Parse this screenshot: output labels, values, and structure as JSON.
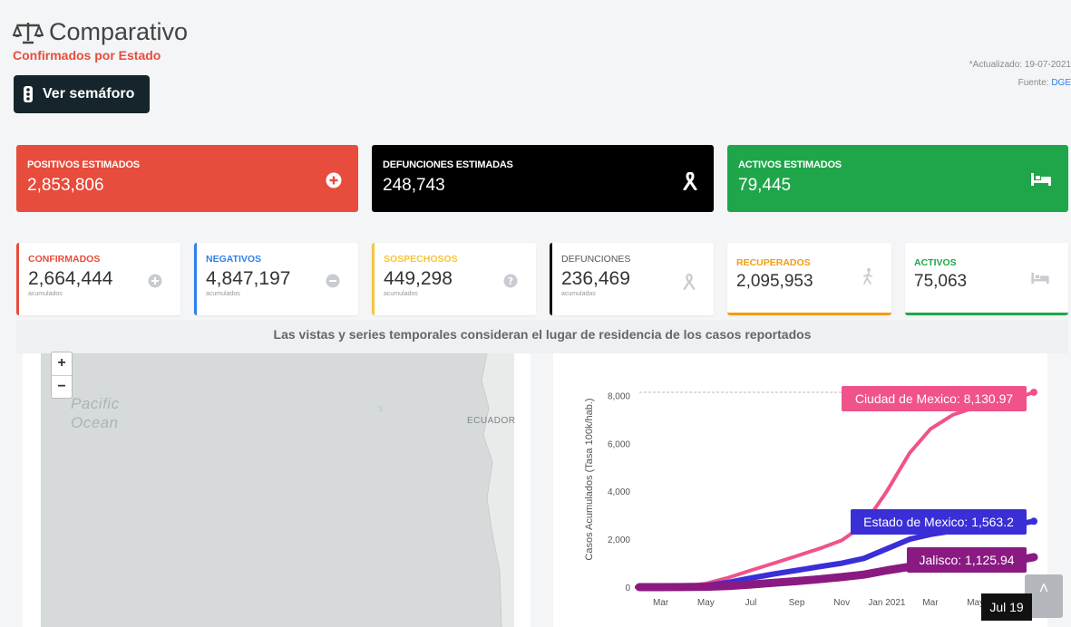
{
  "header": {
    "title": "Comparativo",
    "subtitle": "Confirmados por Estado",
    "semaforo_button": "Ver semáforo",
    "updated": "*Actualizado: 19-07-2021",
    "source_label": "Fuente:",
    "source_value": "DGE"
  },
  "big_cards": [
    {
      "label": "POSITIVOS ESTIMADOS",
      "value": "2,853,806",
      "color": "#e74c3c",
      "icon": "plus-circle-icon"
    },
    {
      "label": "DEFUNCIONES ESTIMADAS",
      "value": "248,743",
      "color": "#000000",
      "icon": "ribbon-icon"
    },
    {
      "label": "ACTIVOS ESTIMADOS",
      "value": "79,445",
      "color": "#1fa64a",
      "icon": "bed-icon"
    }
  ],
  "small_cards": [
    {
      "label": "CONFIRMADOS",
      "value": "2,664,444",
      "sub": "acumulados",
      "color": "#e74c3c",
      "icon": "plus-circle-icon"
    },
    {
      "label": "NEGATIVOS",
      "value": "4,847,197",
      "sub": "acumulados",
      "color": "#2f80ed",
      "icon": "minus-circle-icon"
    },
    {
      "label": "SOSPECHOSOS",
      "value": "449,298",
      "sub": "acumulados",
      "color": "#f4c542",
      "icon": "question-circle-icon"
    },
    {
      "label": "DEFUNCIONES",
      "value": "236,469",
      "sub": "acumuladas",
      "color": "#111111",
      "icon": "ribbon-icon"
    },
    {
      "label": "RECUPERADOS",
      "value": "2,095,953",
      "sub": "",
      "color": "#f39c12",
      "icon": "walking-icon"
    },
    {
      "label": "ACTIVOS",
      "value": "75,063",
      "sub": "",
      "color": "#1fa64a",
      "icon": "bed-icon"
    }
  ],
  "note": "Las vistas y series temporales consideran el lugar de residencia de los casos reportados",
  "map": {
    "zoom_in": "+",
    "zoom_out": "−",
    "ocean_line1": "Pacific",
    "ocean_line2": "Ocean",
    "country": "ECUADOR"
  },
  "tooltip": "Jul 19",
  "scroll_top": "˄",
  "chart_data": {
    "type": "line",
    "title": "",
    "xlabel": "",
    "ylabel": "Casos Acumulados (Tasa 100k/hab.)",
    "x_ticks": [
      "Mar",
      "May",
      "Jul",
      "Sep",
      "Nov",
      "Jan 2021",
      "Mar",
      "May"
    ],
    "y_ticks": [
      "0",
      "2,000",
      "4,000",
      "6,000",
      "8,000"
    ],
    "ylim": [
      0,
      9000
    ],
    "x": [
      "2020-02-01",
      "2020-03-01",
      "2020-04-01",
      "2020-05-01",
      "2020-06-01",
      "2020-07-01",
      "2020-08-01",
      "2020-09-01",
      "2020-10-01",
      "2020-11-01",
      "2020-12-01",
      "2021-01-01",
      "2021-02-01",
      "2021-03-01",
      "2021-04-01",
      "2021-05-01",
      "2021-06-01",
      "2021-07-01",
      "2021-07-19"
    ],
    "series": [
      {
        "name": "Ciudad de Mexico",
        "color": "#f0528c",
        "label": "Ciudad de Mexico: 8,130.97",
        "values": [
          0,
          2,
          30,
          150,
          400,
          700,
          1000,
          1300,
          1600,
          1950,
          2600,
          4000,
          5600,
          6600,
          7200,
          7500,
          7700,
          7950,
          8130.97
        ]
      },
      {
        "name": "Estado de Mexico",
        "color": "#3a2fd6",
        "label": "Estado de Mexico: 1,563.2",
        "values": [
          0,
          0,
          5,
          60,
          200,
          380,
          550,
          700,
          850,
          1000,
          1200,
          1600,
          2000,
          2200,
          2350,
          2450,
          2500,
          2650,
          2750
        ]
      },
      {
        "name": "Jalisco",
        "color": "#8a1a82",
        "label": "Jalisco: 1,125.94",
        "values": [
          0,
          0,
          2,
          15,
          50,
          110,
          180,
          250,
          330,
          420,
          520,
          700,
          850,
          950,
          1020,
          1060,
          1090,
          1150,
          1250
        ]
      }
    ]
  }
}
